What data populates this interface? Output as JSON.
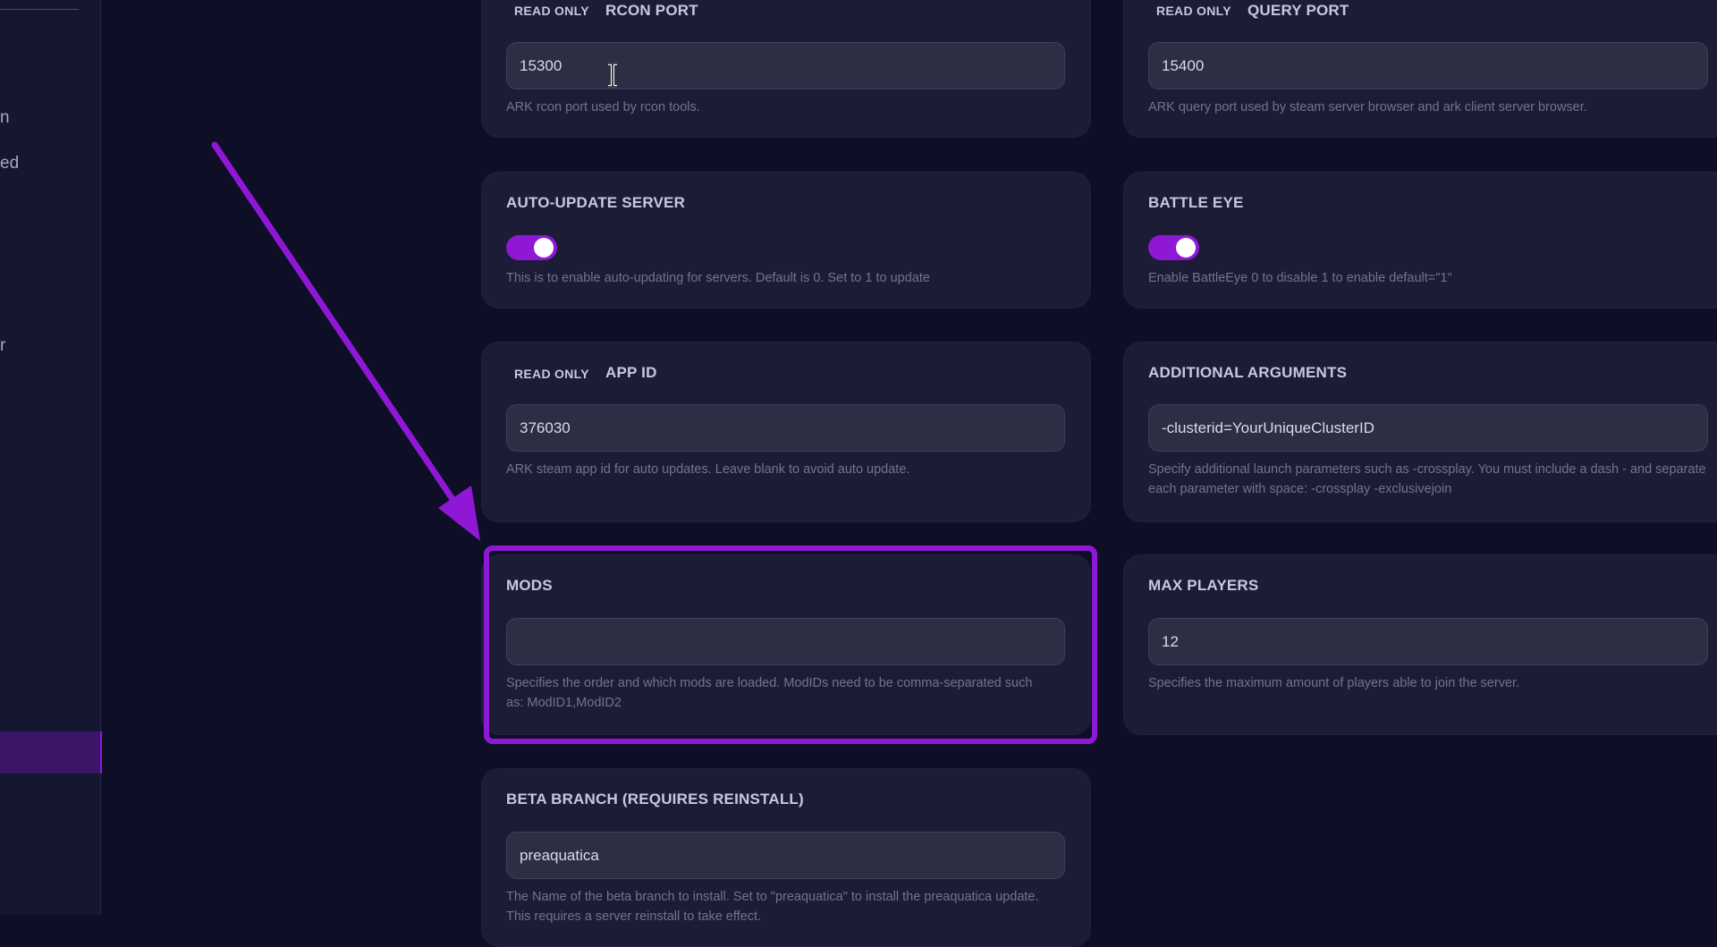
{
  "sidebar": {
    "fragments": [
      "n",
      "ed",
      "r"
    ]
  },
  "cards": {
    "rcon_port": {
      "readonly_tag": "READ ONLY",
      "label": "RCON PORT",
      "value": "15300",
      "help": "ARK rcon port used by rcon tools."
    },
    "query_port": {
      "readonly_tag": "READ ONLY",
      "label": "QUERY PORT",
      "value": "15400",
      "help": "ARK query port used by steam server browser and ark client server browser."
    },
    "auto_update": {
      "label": "AUTO-UPDATE SERVER",
      "enabled": true,
      "help": "This is to enable auto-updating for servers. Default is 0. Set to 1 to update"
    },
    "battle_eye": {
      "label": "BATTLE EYE",
      "enabled": true,
      "help": "Enable BattleEye 0 to disable 1 to enable default=\"1\""
    },
    "app_id": {
      "readonly_tag": "READ ONLY",
      "label": "APP ID",
      "value": "376030",
      "help": "ARK steam app id for auto updates. Leave blank to avoid auto update."
    },
    "additional_arguments": {
      "label": "ADDITIONAL ARGUMENTS",
      "value": "-clusterid=YourUniqueClusterID",
      "help": "Specify additional launch parameters such as -crossplay. You must include a dash - and separate each parameter with space: -crossplay -exclusivejoin"
    },
    "mods": {
      "label": "MODS",
      "value": "",
      "help": "Specifies the order and which mods are loaded. ModIDs need to be comma-separated such as: ModID1,ModID2"
    },
    "max_players": {
      "label": "MAX PLAYERS",
      "value": "12",
      "help": "Specifies the maximum amount of players able to join the server."
    },
    "beta_branch": {
      "label": "BETA BRANCH (REQUIRES REINSTALL)",
      "value": "preaquatica",
      "help": "The Name of the beta branch to install. Set to \"preaquatica\" to install the preaquatica update. This requires a server reinstall to take effect."
    }
  },
  "colors": {
    "background": "#0e0f27",
    "card": "#1c1c37",
    "accent": "#8e18d6",
    "input": "#2d2d44"
  }
}
